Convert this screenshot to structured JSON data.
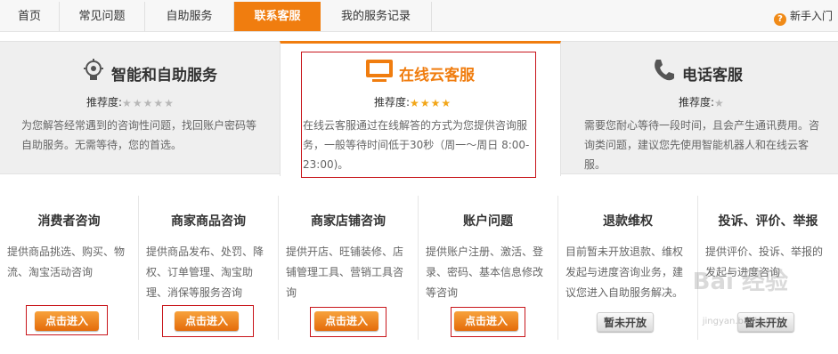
{
  "nav": {
    "tabs": [
      {
        "label": "首页"
      },
      {
        "label": "常见问题"
      },
      {
        "label": "自助服务"
      },
      {
        "label": "联系客服"
      },
      {
        "label": "我的服务记录"
      }
    ],
    "help_label": "新手入门",
    "help_icon": "question-circle-icon"
  },
  "cards": {
    "smart": {
      "title": "智能和自助服务",
      "rec_label": "推荐度:",
      "rating": 1,
      "desc_line1": "为您解答经常遇到的咨询性问题，找回账户密码等",
      "desc_line2": "自助服务。无需等待，您的首选。",
      "icon": "lightbulb-icon"
    },
    "online": {
      "title": "在线云客服",
      "rec_label": "推荐度:",
      "rating": 4,
      "desc_line1": "在线云客服通过在线解答的方式为您提供咨询服",
      "desc_line2": "务，一般等待时间低于30秒（周一～周日 8:00-",
      "desc_line3": "23:00)。",
      "icon": "monitor-icon"
    },
    "phone": {
      "title": "电话客服",
      "rec_label": "推荐度:",
      "rating": 1,
      "desc_line1": "需要您耐心等待一段时间，且会产生通讯费用。咨",
      "desc_line2": "询类问题，建议您先使用智能机器人和在线云客",
      "desc_line3": "服。",
      "icon": "phone-handset-icon"
    }
  },
  "categories": [
    {
      "title": "消费者咨询",
      "lines": [
        "提供商品挑选、购买、物",
        "流、淘宝活动咨询"
      ],
      "button": "点击进入"
    },
    {
      "title": "商家商品咨询",
      "lines": [
        "提供商品发布、处罚、降",
        "权、订单管理、淘宝助",
        "理、消保等服务咨询"
      ],
      "button": "点击进入"
    },
    {
      "title": "商家店铺咨询",
      "lines": [
        "提供开店、旺铺装修、店",
        "铺管理工具、营销工具咨",
        "询"
      ],
      "button": "点击进入"
    },
    {
      "title": "账户问题",
      "lines": [
        "提供账户注册、激活、登",
        "录、密码、基本信息修改",
        "等咨询"
      ],
      "button": "点击进入"
    },
    {
      "title": "退款维权",
      "lines": [
        "目前暂未开放退款、维权",
        "发起与进度咨询业务，建",
        "议您进入自助服务解决。"
      ],
      "button": "暂未开放"
    },
    {
      "title": "投诉、评价、举报",
      "lines": [
        "提供评价、投诉、举报的",
        "发起与进度咨询"
      ],
      "button": "暂未开放"
    }
  ],
  "watermark": {
    "text": "Bai 经验",
    "sub": "jingyan.baidu.com"
  },
  "colors": {
    "accent": "#f07d0f",
    "highlight_box": "#c8151b",
    "star": "#f2a618"
  }
}
